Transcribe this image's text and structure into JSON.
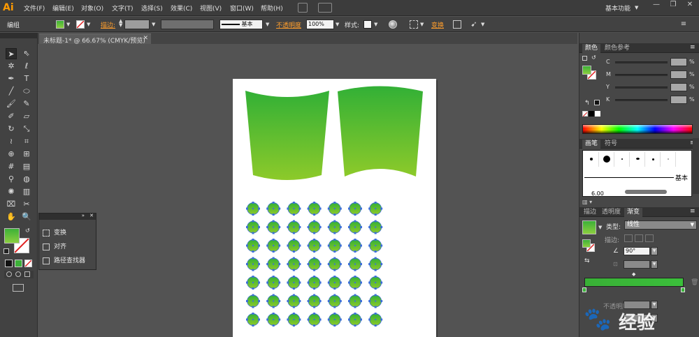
{
  "app": {
    "logo": "Ai",
    "menus": [
      "文件(F)",
      "编辑(E)",
      "对象(O)",
      "文字(T)",
      "选择(S)",
      "效果(C)",
      "视图(V)",
      "窗口(W)",
      "帮助(H)"
    ],
    "workspace": "基本功能",
    "window_buttons": [
      "—",
      "❐",
      "✕"
    ]
  },
  "control_bar": {
    "selection_type": "编组",
    "stroke_label": "描边:",
    "stroke_style": "基本",
    "opacity_label": "不透明度",
    "opacity_value": "100%",
    "style_label": "样式:",
    "transform_label": "变换",
    "fill_color": "#3cb138"
  },
  "document": {
    "tab_title": "未标题-1* @ 66.67% (CMYK/预览)"
  },
  "floating_panel": {
    "items": [
      "变换",
      "对齐",
      "路径查找器"
    ]
  },
  "panels": {
    "color": {
      "tabs": [
        "颜色",
        "颜色参考"
      ],
      "channels": [
        {
          "label": "C",
          "unit": "%"
        },
        {
          "label": "M",
          "unit": "%"
        },
        {
          "label": "Y",
          "unit": "%"
        },
        {
          "label": "K",
          "unit": "%"
        }
      ]
    },
    "brush": {
      "tabs": [
        "画笔",
        "符号"
      ],
      "stroke_name": "基本",
      "size_label": "6.00"
    },
    "gradient": {
      "tabs": [
        "描边",
        "透明度",
        "渐变"
      ],
      "type_label": "类型:",
      "type_value": "线性",
      "stroke_label": "描边:",
      "angle_value": "90°",
      "opacity_label": "不透明度",
      "start_color": "#39b036",
      "end_color": "#3bbf3b"
    }
  },
  "artwork": {
    "gradient_top": "#32b036",
    "gradient_bottom": "#8dca2a",
    "dot_rows": 7,
    "dot_cols": 7
  },
  "watermark": {
    "text": "经验"
  }
}
